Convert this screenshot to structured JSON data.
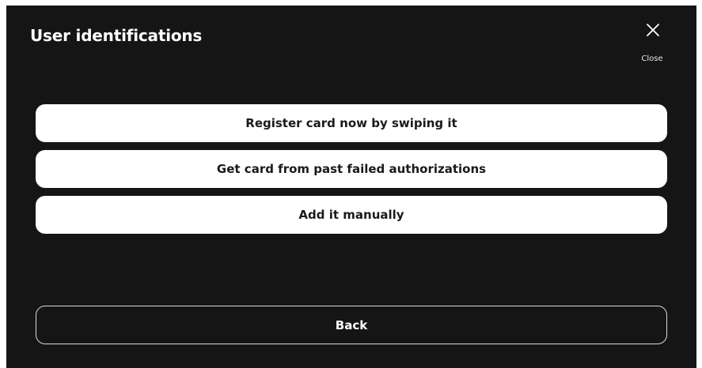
{
  "dialog": {
    "title": "User identifications",
    "close_label": "Close",
    "close_icon": "close-icon"
  },
  "options": [
    {
      "label": "Register card now by swiping it"
    },
    {
      "label": "Get card from past failed authorizations"
    },
    {
      "label": "Add it manually"
    }
  ],
  "footer": {
    "back_label": "Back"
  },
  "colors": {
    "background": "#151515",
    "button_fill": "#ffffff",
    "button_text": "#1a1a1a",
    "outline": "#d9d9d9",
    "text": "#ffffff"
  }
}
